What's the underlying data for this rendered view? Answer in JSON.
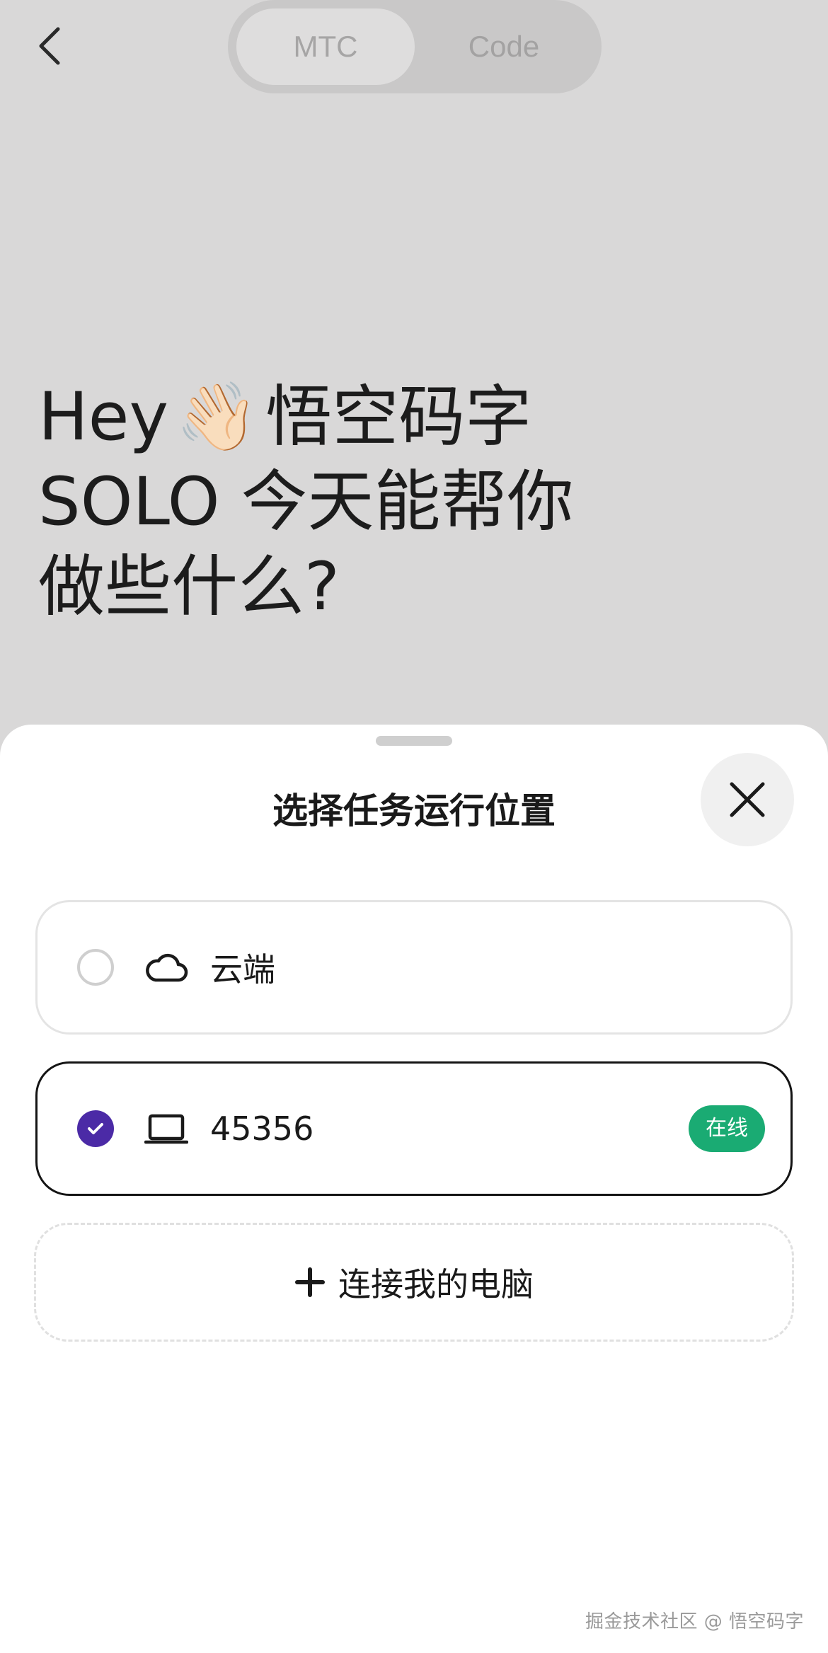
{
  "header": {
    "back_icon": "chevron-left-icon",
    "tabs": [
      {
        "label": "MTC",
        "active": true
      },
      {
        "label": "Code",
        "active": false
      }
    ]
  },
  "greeting": {
    "line1_prefix": "Hey",
    "wave_emoji": "👋🏻",
    "line1_suffix": "悟空码字",
    "line2": "SOLO 今天能帮你",
    "line3": "做些什么?"
  },
  "sheet": {
    "title": "选择任务运行位置",
    "close_icon": "close-icon",
    "options": [
      {
        "label": "云端",
        "icon": "cloud-icon",
        "selected": false
      },
      {
        "label": "45356",
        "icon": "laptop-icon",
        "selected": true,
        "status": "在线"
      }
    ],
    "connect_label": "连接我的电脑"
  },
  "colors": {
    "accent": "#4b2aa6",
    "online": "#1aab73",
    "overlay_bg": "#d9d8d8"
  },
  "watermark": "掘金技术社区 @ 悟空码字"
}
